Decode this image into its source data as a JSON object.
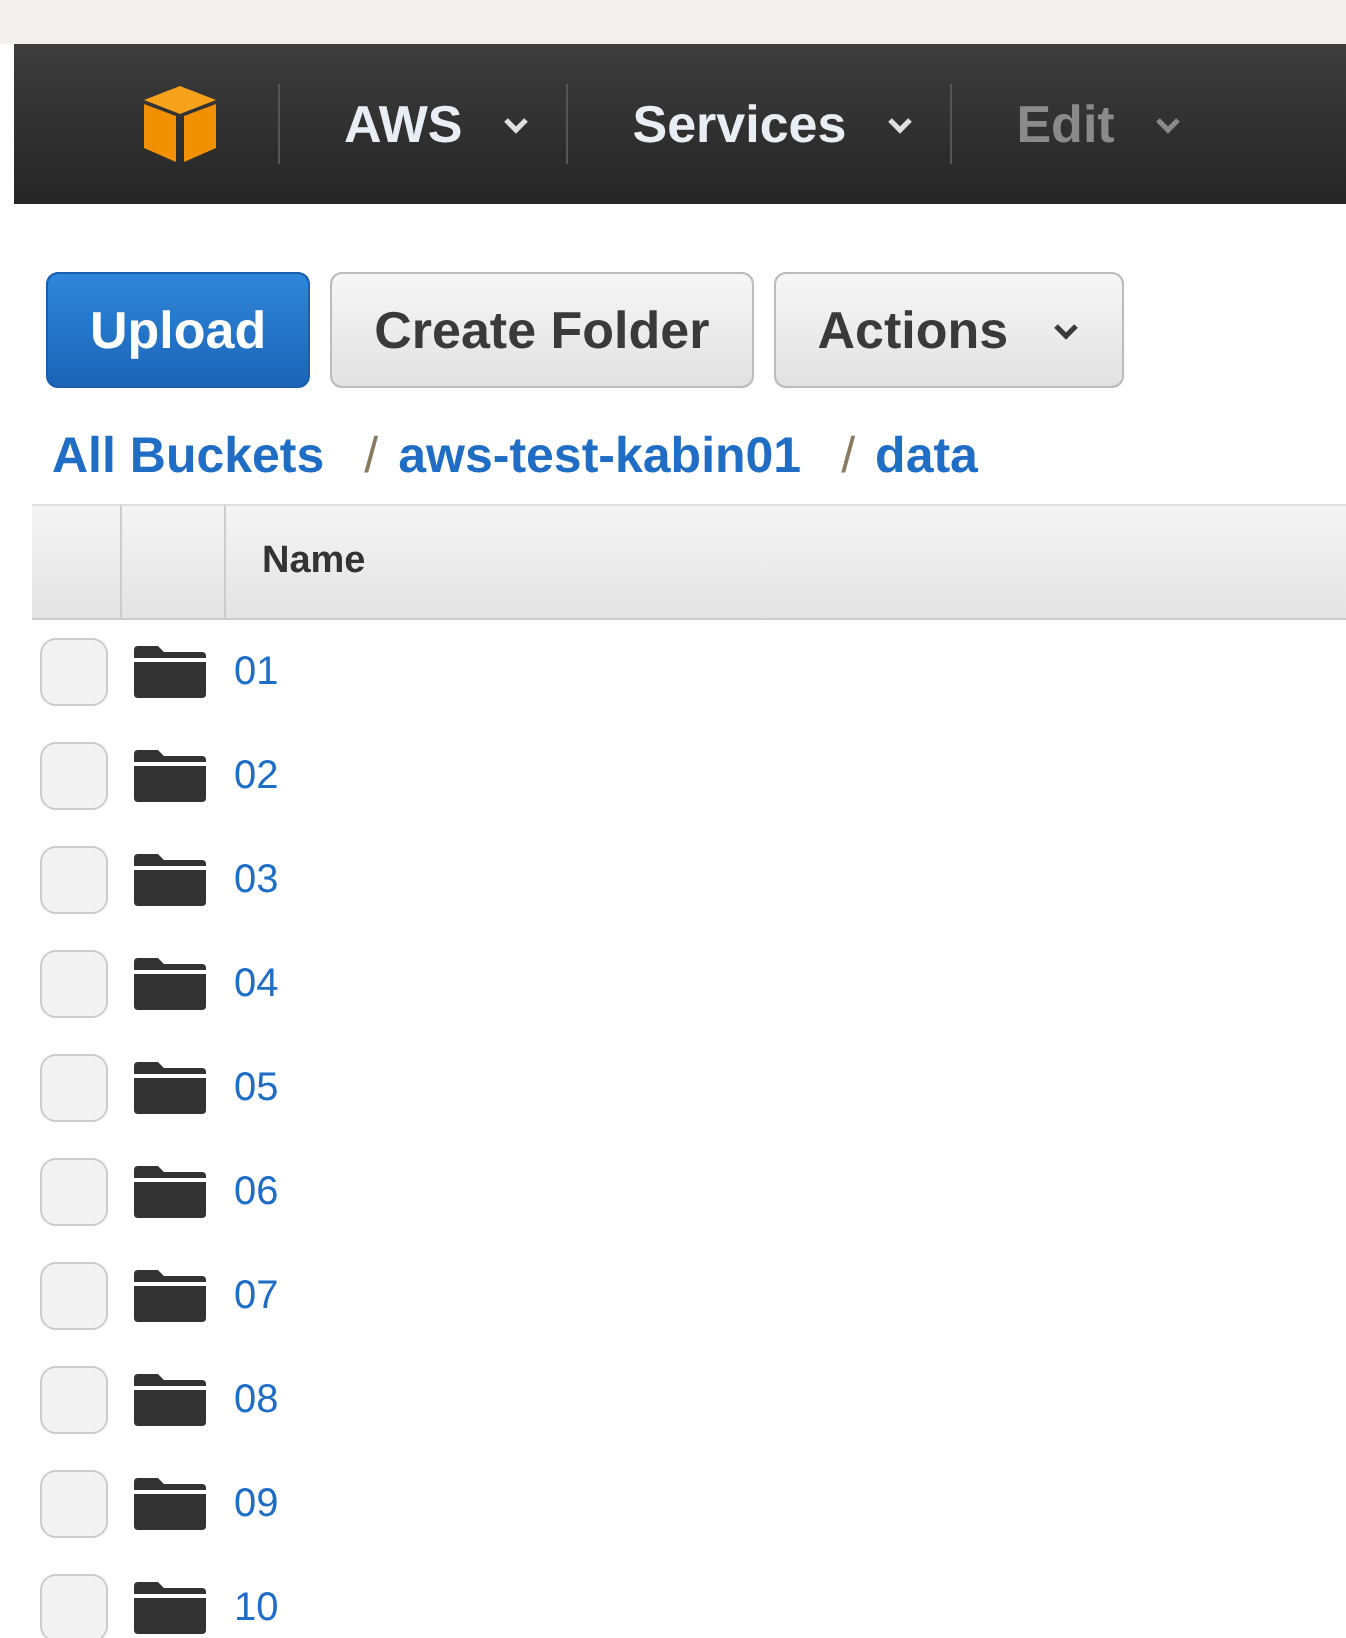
{
  "nav": {
    "items": [
      {
        "label": "AWS",
        "disabled": false
      },
      {
        "label": "Services",
        "disabled": false
      },
      {
        "label": "Edit",
        "disabled": true
      }
    ]
  },
  "toolbar": {
    "buttons": [
      {
        "label": "Upload",
        "kind": "primary"
      },
      {
        "label": "Create Folder",
        "kind": "plain"
      },
      {
        "label": "Actions",
        "kind": "dropdown"
      }
    ]
  },
  "breadcrumbs": [
    {
      "label": "All Buckets"
    },
    {
      "separator": "/",
      "label": "aws-test-kabin01"
    },
    {
      "separator": "/",
      "label": "data"
    }
  ],
  "table": {
    "columns": [
      "Name"
    ],
    "rows": [
      {
        "name": "01",
        "checked": false
      },
      {
        "name": "02",
        "checked": false
      },
      {
        "name": "03",
        "checked": false
      },
      {
        "name": "04",
        "checked": false
      },
      {
        "name": "05",
        "checked": false
      },
      {
        "name": "06",
        "checked": false
      },
      {
        "name": "07",
        "checked": false
      },
      {
        "name": "08",
        "checked": false
      },
      {
        "name": "09",
        "checked": false
      },
      {
        "name": "10",
        "checked": false
      }
    ]
  }
}
